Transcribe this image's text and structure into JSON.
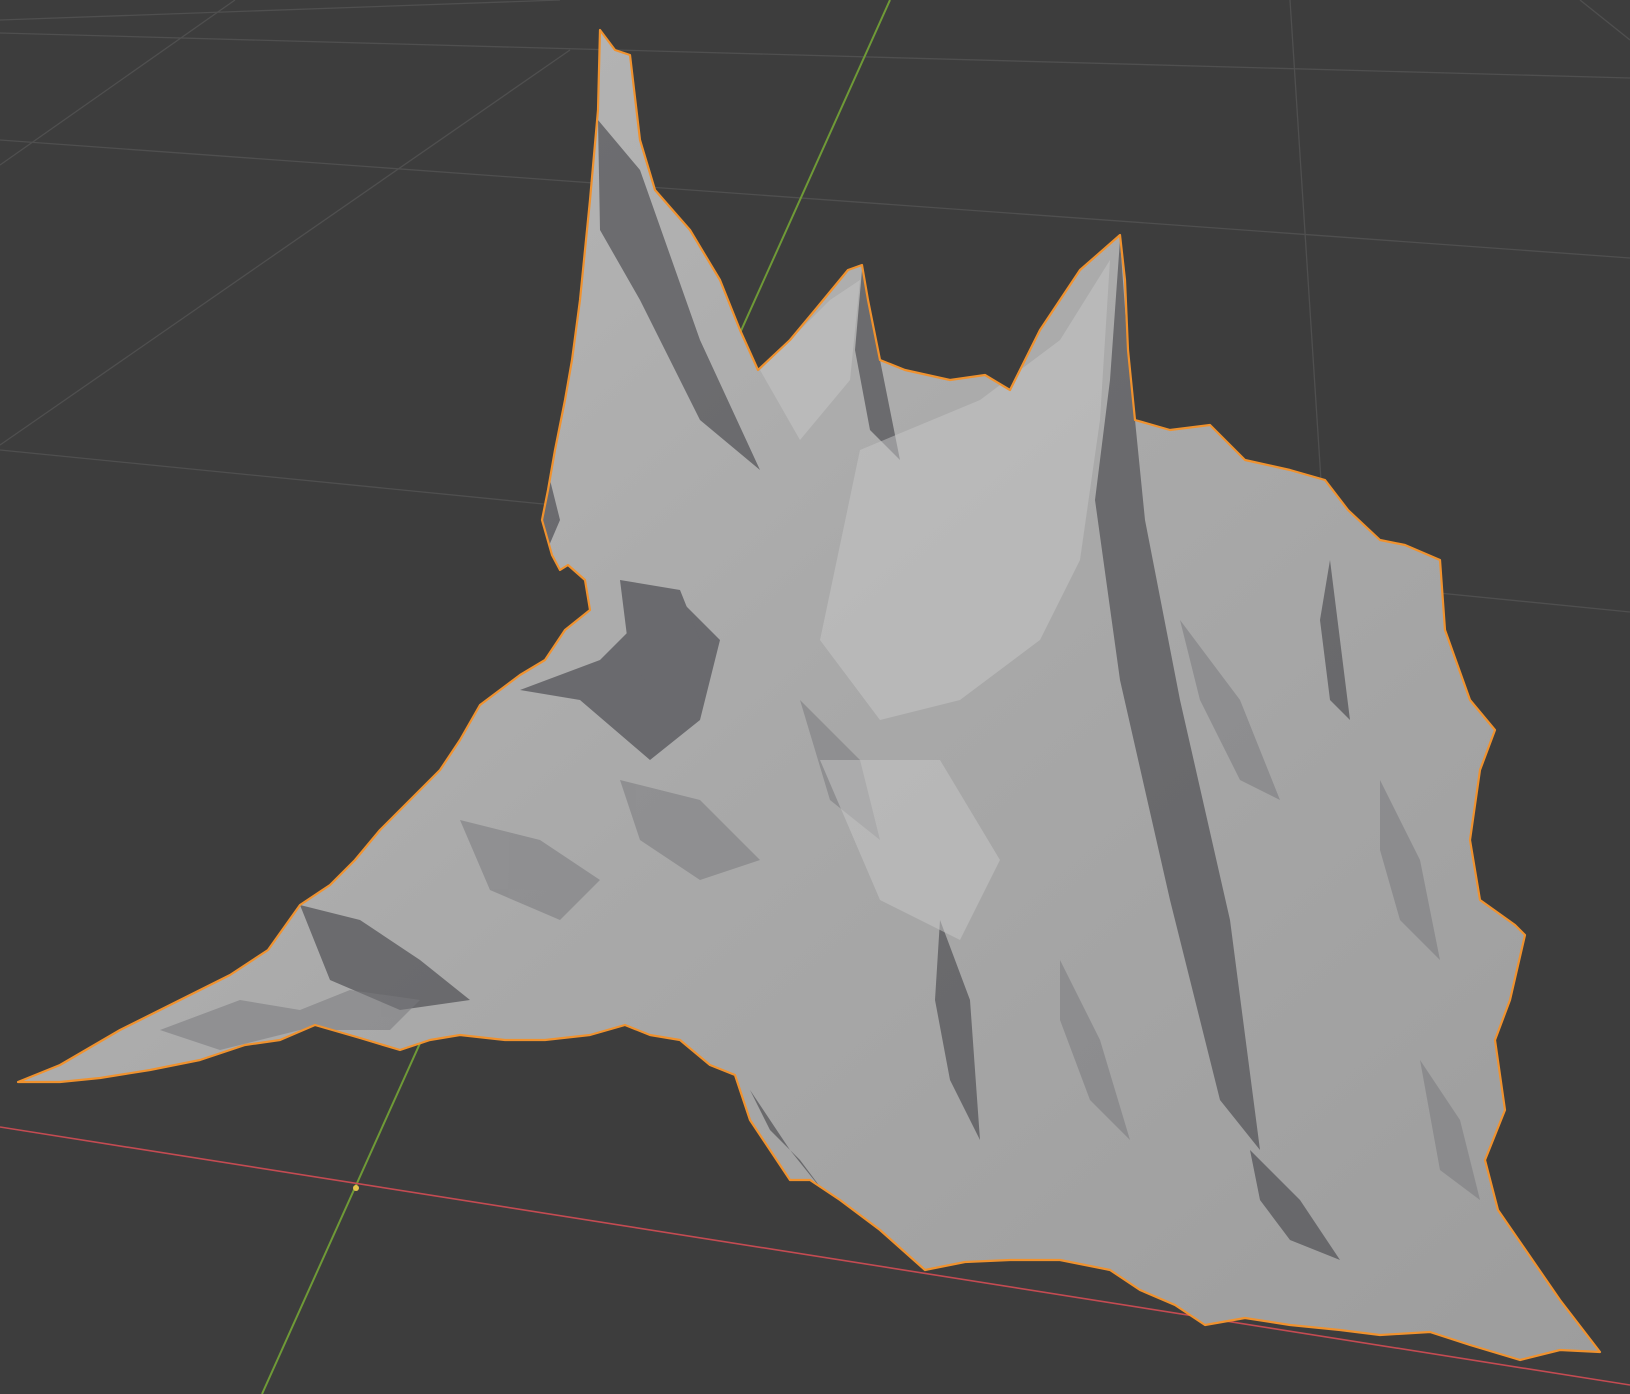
{
  "viewport": {
    "background": "#3d3d3d",
    "grid_color": "#4f4f4f",
    "x_axis_color": "#c44b52",
    "y_axis_color": "#6f9a37",
    "selection_outline_color": "#f0922e",
    "mesh_base_color": "#a6a6a6",
    "mesh_shadow_color": "#4a4a4d",
    "mesh_highlight_color": "#c4c4c4",
    "origin_marker_color": "#e3c34a",
    "selected_object": "terrain-mesh",
    "shading_mode": "solid"
  }
}
